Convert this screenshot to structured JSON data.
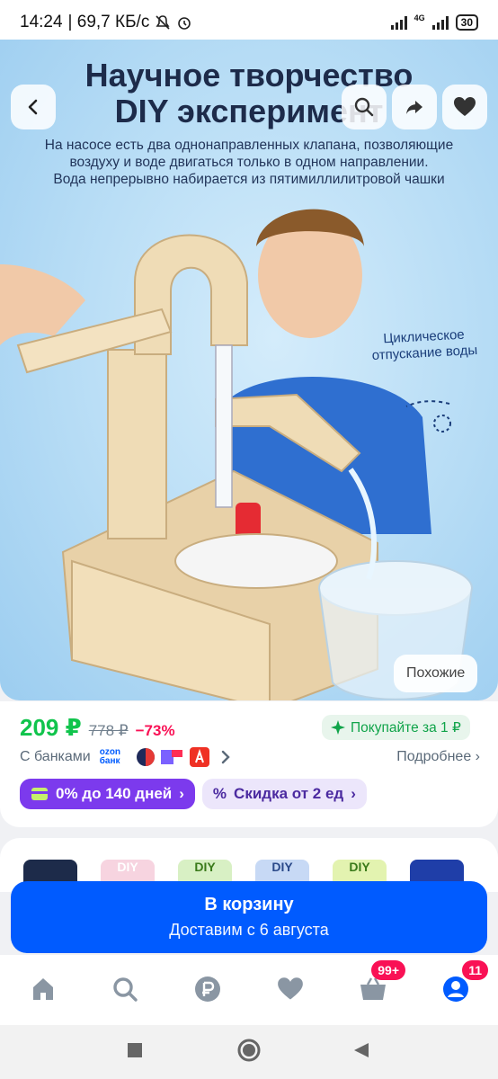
{
  "status_bar": {
    "time": "14:24",
    "speed": "| 69,7 КБ/с",
    "network": "4G",
    "battery": "30"
  },
  "hero": {
    "title_line1": "Научное творчество",
    "title_line2": "DIY эксперимент",
    "subtitle_line1": "На насосе есть два однонаправленных клапана, позволяющие",
    "subtitle_line2": "воздуху и воде двигаться только в одном направлении.",
    "subtitle_line3": "Вода непрерывно набирается из пятимиллилитровой чашки",
    "note_line1": "Циклическое",
    "note_line2": "отпускание воды",
    "similar_label": "Похожие"
  },
  "product": {
    "price": "209 ₽",
    "old_price": "778 ₽",
    "discount": "−73%",
    "buy_for": "Покупайте за 1 ₽",
    "banks_label": "С банками",
    "ozon_bank_logo_text": "ozon банк",
    "more_label": "Подробнее",
    "installment_label": "0% до 140 дней",
    "bulk_discount_label": "Скидка от 2 ед"
  },
  "thumbnails": {
    "items": [
      "",
      "DIY",
      "DIY",
      "DIY",
      "DIY",
      ""
    ]
  },
  "cart": {
    "button_label": "В корзину",
    "delivery": "Доставим с 6 августа"
  },
  "bottom_nav": {
    "cart_badge": "99+",
    "profile_badge": "11"
  },
  "colors": {
    "accent": "#005bff",
    "price_green": "#10c44c",
    "discount_red": "#f91155",
    "installment_purple": "#7c3aed"
  }
}
